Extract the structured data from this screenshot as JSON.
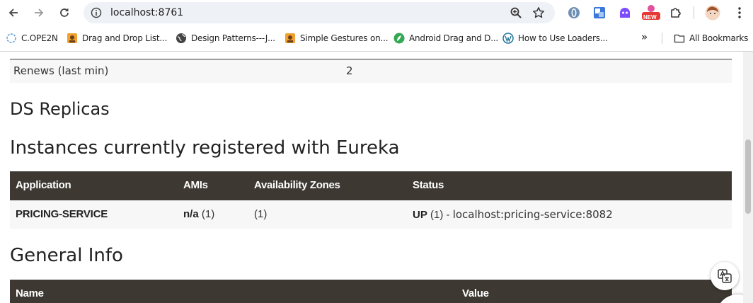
{
  "browser": {
    "url": "localhost:8761",
    "new_badge": "NEW"
  },
  "bookmarks": {
    "items": [
      {
        "label": "C.OPE2N",
        "icon": "loading-circle-icon"
      },
      {
        "label": "Drag and Drop List...",
        "icon": "page-favicon"
      },
      {
        "label": "Design Patterns---J...",
        "icon": "globe-icon"
      },
      {
        "label": "Simple Gestures on...",
        "icon": "page-favicon"
      },
      {
        "label": "Android Drag and D...",
        "icon": "green-leaf-favicon"
      },
      {
        "label": "How to Use Loaders...",
        "icon": "wordpress-icon"
      }
    ],
    "overflow": "»",
    "all_bookmarks": "All Bookmarks"
  },
  "page": {
    "renews": {
      "label": "Renews (last min)",
      "value": "2"
    },
    "ds_replicas_title": "DS Replicas",
    "instances_title": "Instances currently registered with Eureka",
    "instances_table": {
      "headers": [
        "Application",
        "AMIs",
        "Availability Zones",
        "Status"
      ],
      "rows": [
        {
          "application": "PRICING-SERVICE",
          "amis_bold": "n/a",
          "amis_count": "(1)",
          "zones": "(1)",
          "status_bold": "UP",
          "status_rest": "(1) -",
          "status_link": "localhost:pricing-service:8082"
        }
      ]
    },
    "general_info_title": "General Info",
    "general_table": {
      "headers": [
        "Name",
        "Value"
      ]
    }
  },
  "colors": {
    "table_header_bg": "#3d3932",
    "row_bg": "#f7f7f7",
    "link": "#5c9a4e"
  }
}
